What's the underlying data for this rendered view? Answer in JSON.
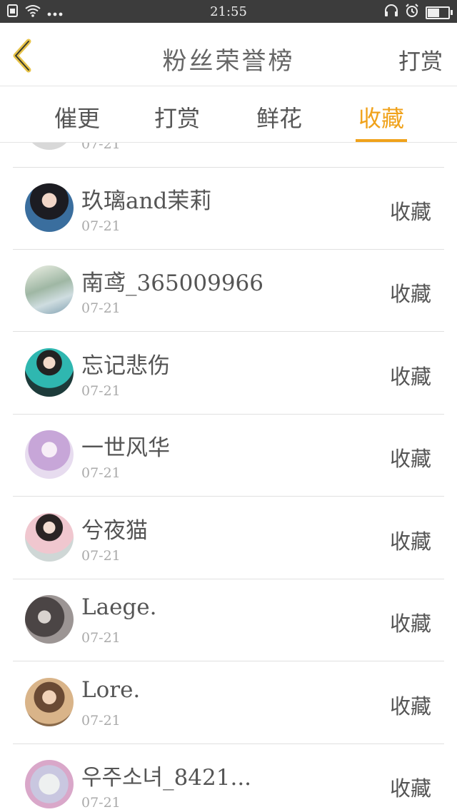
{
  "status_bar": {
    "time": "21:55",
    "battery_level": 0.6,
    "icons": [
      "sim-icon",
      "wifi-icon",
      "more-dots-icon",
      "headset-icon",
      "alarm-icon",
      "battery-icon"
    ]
  },
  "header": {
    "title": "粉丝荣誉榜",
    "right_button": "打赏"
  },
  "tabs": [
    {
      "label": "催更",
      "active": false
    },
    {
      "label": "打赏",
      "active": false
    },
    {
      "label": "鲜花",
      "active": false
    },
    {
      "label": "收藏",
      "active": true
    }
  ],
  "colors": {
    "accent": "#f0a21b",
    "divider": "#e4e4e4",
    "statusbar": "#3c3c3c"
  },
  "list": {
    "partial_top_date": "07-21",
    "items": [
      {
        "name": "玖璃and茉莉",
        "date": "07-21",
        "action": "收藏",
        "avatar": "avatar-image"
      },
      {
        "name": "南鸢_365009966",
        "date": "07-21",
        "action": "收藏",
        "avatar": "avatar-image"
      },
      {
        "name": "忘记悲伤",
        "date": "07-21",
        "action": "收藏",
        "avatar": "avatar-image"
      },
      {
        "name": "一世风华",
        "date": "07-21",
        "action": "收藏",
        "avatar": "avatar-image"
      },
      {
        "name": "兮夜猫",
        "date": "07-21",
        "action": "收藏",
        "avatar": "avatar-image"
      },
      {
        "name": "Laege.",
        "date": "07-21",
        "action": "收藏",
        "avatar": "avatar-image"
      },
      {
        "name": "Lore.",
        "date": "07-21",
        "action": "收藏",
        "avatar": "avatar-image"
      },
      {
        "name": "우주소녀_8421...",
        "date": "07-21",
        "action": "收藏",
        "avatar": "avatar-image"
      }
    ]
  }
}
